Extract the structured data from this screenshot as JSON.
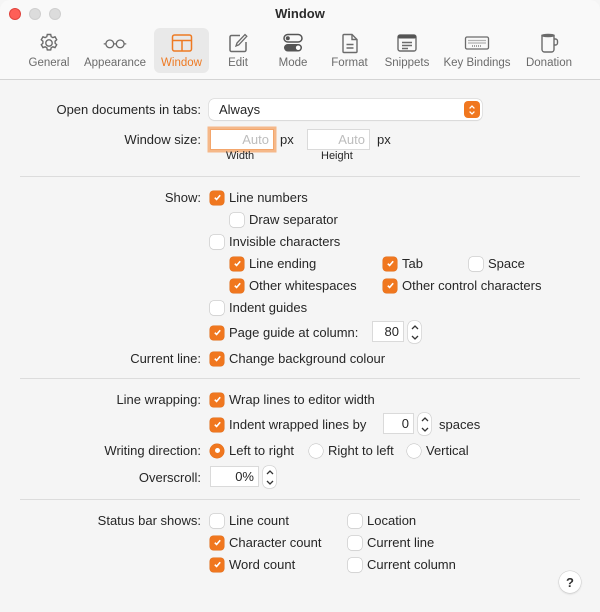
{
  "window": {
    "title": "Window",
    "accent_color": "#f0771f"
  },
  "toolbar": {
    "items": [
      {
        "label": "General",
        "icon": "gear-icon",
        "selected": false
      },
      {
        "label": "Appearance",
        "icon": "glasses-icon",
        "selected": false
      },
      {
        "label": "Window",
        "icon": "window-layout-icon",
        "selected": true
      },
      {
        "label": "Edit",
        "icon": "edit-pencil-icon",
        "selected": false
      },
      {
        "label": "Mode",
        "icon": "toggles-icon",
        "selected": false
      },
      {
        "label": "Format",
        "icon": "document-icon",
        "selected": false
      },
      {
        "label": "Snippets",
        "icon": "snippets-icon",
        "selected": false
      },
      {
        "label": "Key Bindings",
        "icon": "keyboard-icon",
        "selected": false
      },
      {
        "label": "Donation",
        "icon": "mug-icon",
        "selected": false
      }
    ]
  },
  "tabs_section": {
    "open_in_tabs_label": "Open documents in tabs:",
    "open_in_tabs_value": "Always",
    "window_size_label": "Window size:",
    "width_placeholder": "Auto",
    "height_placeholder": "Auto",
    "unit": "px",
    "width_label": "Width",
    "height_label": "Height"
  },
  "show_section": {
    "show_label": "Show:",
    "line_numbers": {
      "label": "Line numbers",
      "checked": true
    },
    "draw_separator": {
      "label": "Draw separator",
      "checked": false
    },
    "invisible_characters": {
      "label": "Invisible characters",
      "checked": false
    },
    "line_ending": {
      "label": "Line ending",
      "checked": true
    },
    "tab": {
      "label": "Tab",
      "checked": true
    },
    "space": {
      "label": "Space",
      "checked": false
    },
    "other_whitespaces": {
      "label": "Other whitespaces",
      "checked": true
    },
    "other_control": {
      "label": "Other control characters",
      "checked": true
    },
    "indent_guides": {
      "label": "Indent guides",
      "checked": false
    },
    "page_guide": {
      "label": "Page guide at column:",
      "checked": true,
      "value": "80"
    },
    "current_line_label": "Current line:",
    "change_bg": {
      "label": "Change background colour",
      "checked": true
    }
  },
  "wrap_section": {
    "line_wrapping_label": "Line wrapping:",
    "wrap_lines": {
      "label": "Wrap lines to editor width",
      "checked": true
    },
    "indent_wrapped": {
      "label": "Indent wrapped lines by",
      "checked": true,
      "value": "0",
      "unit": "spaces"
    },
    "writing_direction_label": "Writing direction:",
    "directions": [
      {
        "label": "Left to right",
        "selected": true
      },
      {
        "label": "Right to left",
        "selected": false
      },
      {
        "label": "Vertical",
        "selected": false
      }
    ],
    "overscroll_label": "Overscroll:",
    "overscroll_value": "0%"
  },
  "status_section": {
    "label": "Status bar shows:",
    "line_count": {
      "label": "Line count",
      "checked": false
    },
    "character_count": {
      "label": "Character count",
      "checked": true
    },
    "word_count": {
      "label": "Word count",
      "checked": true
    },
    "location": {
      "label": "Location",
      "checked": false
    },
    "current_line": {
      "label": "Current line",
      "checked": false
    },
    "current_column": {
      "label": "Current column",
      "checked": false
    }
  },
  "help_label": "?"
}
